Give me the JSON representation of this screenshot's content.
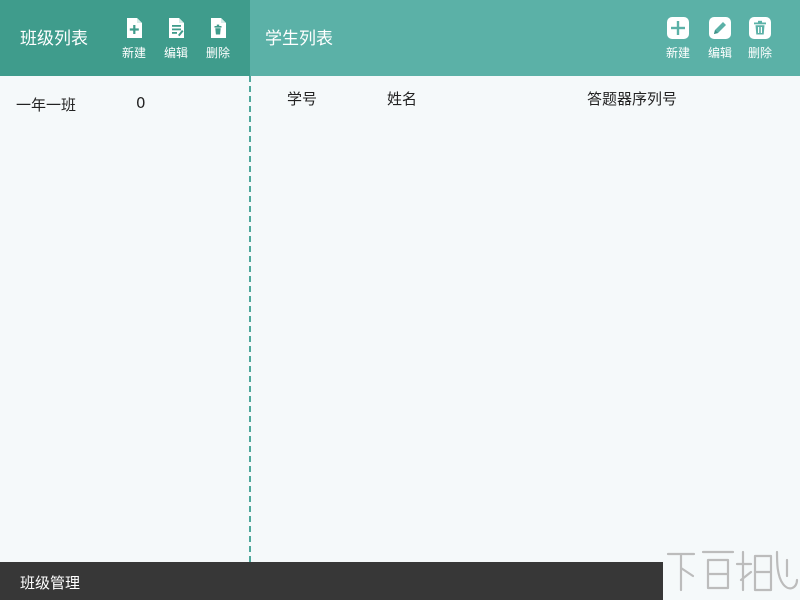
{
  "class_panel": {
    "title": "班级列表",
    "buttons": [
      {
        "icon": "file-plus-icon",
        "label": "新建"
      },
      {
        "icon": "file-edit-icon",
        "label": "编辑"
      },
      {
        "icon": "file-delete-icon",
        "label": "删除"
      }
    ],
    "classes": [
      {
        "name": "一年一班",
        "count": "0"
      }
    ]
  },
  "student_panel": {
    "title": "学生列表",
    "buttons": [
      {
        "icon": "plus-icon",
        "label": "新建"
      },
      {
        "icon": "pencil-icon",
        "label": "编辑"
      },
      {
        "icon": "trash-icon",
        "label": "删除"
      }
    ],
    "columns": [
      "学号",
      "姓名",
      "答题器序列号"
    ]
  },
  "status_bar": {
    "text": "班级管理"
  },
  "colors": {
    "left_header": "#3f9c8c",
    "right_header": "#5bb1a7",
    "content_bg": "#f5f9fa",
    "divider": "#4fa89c",
    "status_bar": "#373737"
  }
}
